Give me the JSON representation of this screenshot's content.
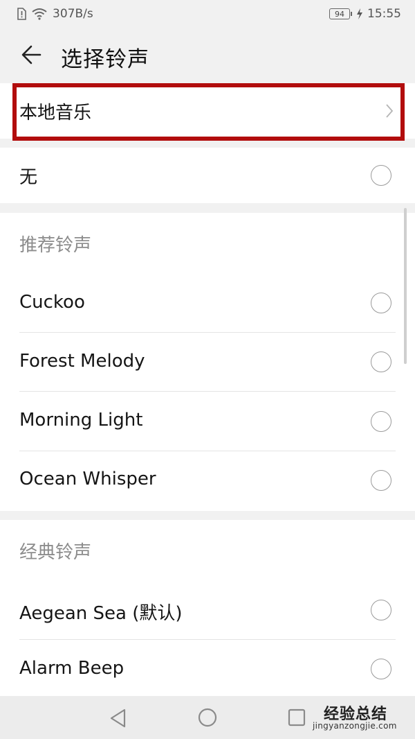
{
  "status_bar": {
    "network_speed": "307B/s",
    "battery_level": "94",
    "time": "15:55"
  },
  "header": {
    "title": "选择铃声"
  },
  "local_music": {
    "label": "本地音乐"
  },
  "none_option": {
    "label": "无"
  },
  "recommended": {
    "section_title": "推荐铃声",
    "items": [
      {
        "label": "Cuckoo"
      },
      {
        "label": "Forest Melody"
      },
      {
        "label": "Morning Light"
      },
      {
        "label": "Ocean Whisper"
      }
    ]
  },
  "classic": {
    "section_title": "经典铃声",
    "items": [
      {
        "label": "Aegean Sea (默认)"
      },
      {
        "label": "Alarm Beep"
      }
    ]
  },
  "watermark": {
    "text_cn": "经验总结",
    "text_url": "jingyanzongjie.com"
  },
  "colors": {
    "highlight_box": "#b20d0d",
    "background": "#f1f1f1",
    "card": "#ffffff"
  },
  "icons": {
    "back": "arrow-left-icon",
    "chevron": "chevron-right-icon",
    "nav_back": "triangle-back-icon",
    "nav_home": "circle-home-icon",
    "nav_recent": "square-recent-icon"
  }
}
